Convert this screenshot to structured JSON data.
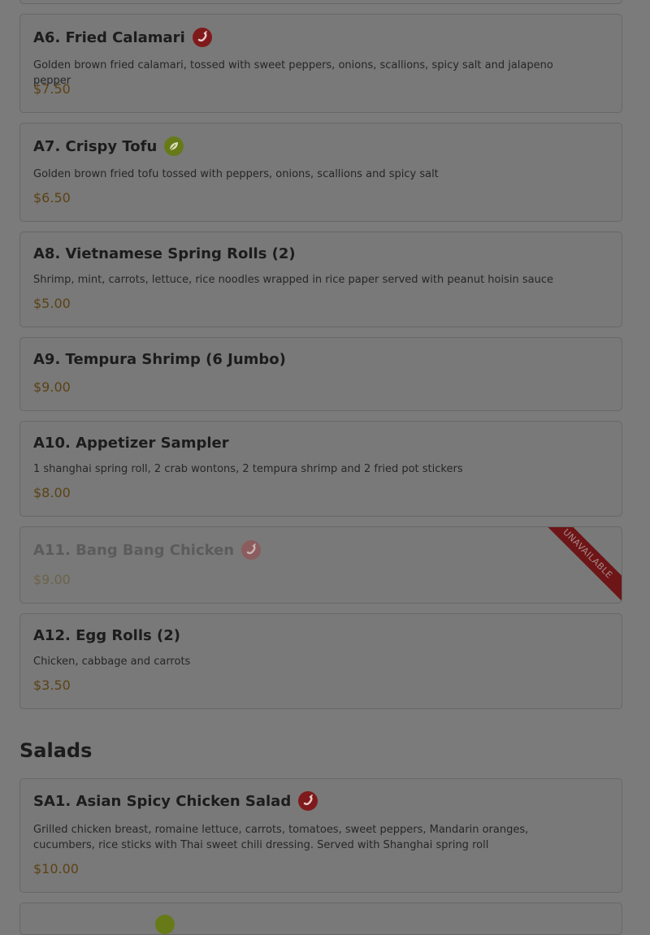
{
  "appetizers": [
    {
      "title": "A6. Fried Calamari",
      "icon": "spicy",
      "desc": "Golden brown fried calamari, tossed with sweet peppers, onions, scallions, spicy salt and jalapeno pepper",
      "price": "$7.50"
    },
    {
      "title": "A7. Crispy Tofu",
      "icon": "vegetarian",
      "desc": "Golden brown fried tofu tossed with peppers, onions, scallions and spicy salt",
      "price": "$6.50"
    },
    {
      "title": "A8. Vietnamese Spring Rolls (2)",
      "desc": "Shrimp, mint, carrots, lettuce, rice noodles wrapped in rice paper served with peanut hoisin sauce",
      "price": "$5.00"
    },
    {
      "title": "A9. Tempura Shrimp (6 Jumbo)",
      "price": "$9.00"
    },
    {
      "title": "A10. Appetizer Sampler",
      "desc": "1 shanghai spring roll, 2 crab wontons, 2 tempura shrimp and 2 fried pot stickers",
      "price": "$8.00"
    },
    {
      "title": "A11. Bang Bang Chicken",
      "icon": "spicy",
      "price": "$9.00",
      "badge": "UNAVAILABLE"
    },
    {
      "title": "A12. Egg Rolls (2)",
      "desc": "Chicken, cabbage and carrots",
      "price": "$3.50"
    }
  ],
  "salads": {
    "section_title": "Salads",
    "items": [
      {
        "title": "SA1. Asian Spicy Chicken Salad",
        "icon": "spicy",
        "desc": "Grilled chicken breast, romaine lettuce, carrots, tomatoes, sweet peppers, Mandarin oranges, cucumbers, rice sticks with Thai sweet chili dressing. Served with Shanghai spring roll",
        "price": "$10.00"
      }
    ]
  },
  "colors": {
    "spicy": "#7f1a1c",
    "vegetarian": "#667a18",
    "price": "#5c4213",
    "unavailable_ribbon": "#6e1517"
  }
}
